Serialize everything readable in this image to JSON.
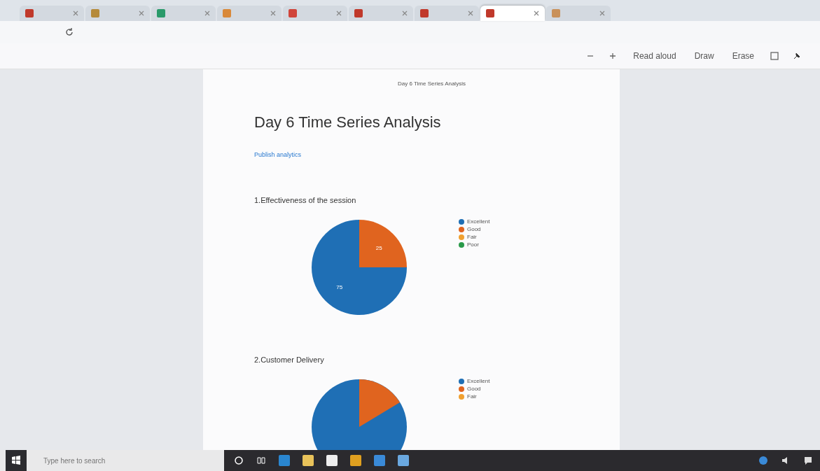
{
  "browser": {
    "tabs": [
      {
        "selected": false
      },
      {
        "selected": false
      },
      {
        "selected": false
      },
      {
        "selected": false
      },
      {
        "selected": false
      },
      {
        "selected": false
      },
      {
        "selected": false
      },
      {
        "selected": true
      },
      {
        "selected": false
      }
    ],
    "pdf_toolbar": {
      "read_aloud": "Read aloud",
      "draw": "Draw",
      "erase": "Erase"
    }
  },
  "page": {
    "running_header": "Day 6 Time Series Analysis",
    "title": "Day 6 Time Series Analysis",
    "link": "Publish analytics",
    "questions": [
      {
        "kind": "chart",
        "legend": [
          {
            "color": "#1f6fb5"
          },
          {
            "color": "#e0641f"
          },
          {
            "color": "#f0a030"
          },
          {
            "color": "#2a9a4a"
          }
        ],
        "chart_data": {
          "type": "pie",
          "title": "1.Effectiveness of the session",
          "categories": [
            "Excellent",
            "Good",
            "Fair",
            "Poor"
          ],
          "series": [
            {
              "values": [
                75,
                25,
                0,
                0
              ]
            }
          ],
          "data_labels": true
        }
      },
      {
        "title": "2.Customer Delivery",
        "kind": "picture",
        "legend": [
          {
            "label": "Excellent",
            "color": "#1f6fb5"
          },
          {
            "label": "Good",
            "color": "#e0641f"
          },
          {
            "label": "Fair",
            "color": "#f0a030"
          }
        ]
      }
    ]
  },
  "taskbar": {
    "search_placeholder": "Type here to search"
  }
}
